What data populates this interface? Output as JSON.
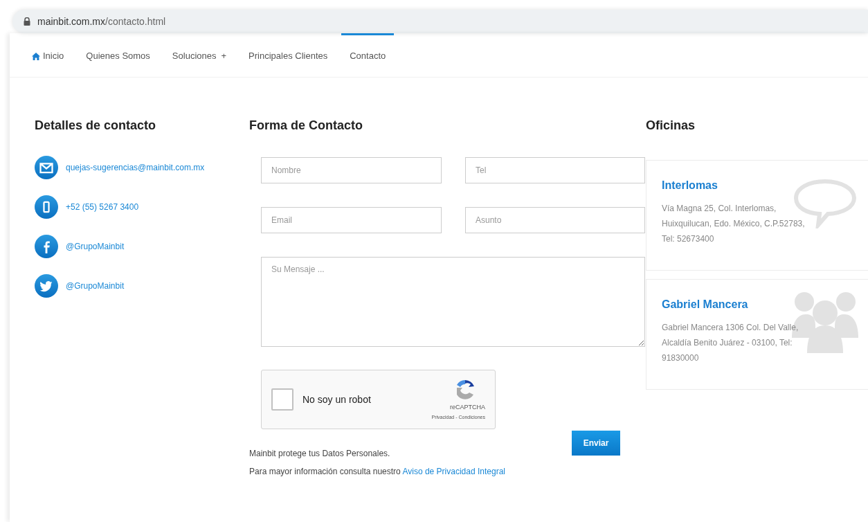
{
  "address_bar": {
    "domain": "mainbit.com.mx",
    "path": "/contacto.html"
  },
  "nav": [
    {
      "label": "Inicio",
      "kind": "home",
      "selected": false
    },
    {
      "label": "Quienes Somos",
      "selected": false
    },
    {
      "label": "Soluciones",
      "suffix": "+",
      "selected": false
    },
    {
      "label": "Principales Clientes",
      "selected": false
    },
    {
      "label": "Contacto",
      "selected": true
    }
  ],
  "contact_details": {
    "title": "Detalles de contacto",
    "items": [
      {
        "kind": "email",
        "text": "quejas-sugerencias@mainbit.com.mx"
      },
      {
        "kind": "phone",
        "text": "+52 (55) 5267 3400"
      },
      {
        "kind": "facebook",
        "text": "@GrupoMainbit"
      },
      {
        "kind": "twitter",
        "text": "@GrupoMainbit"
      }
    ]
  },
  "form": {
    "title": "Forma de Contacto",
    "fields": [
      {
        "placeholder": "Nombre"
      },
      {
        "placeholder": "Tel"
      },
      {
        "placeholder": "Email"
      },
      {
        "placeholder": "Asunto"
      }
    ],
    "message": {
      "placeholder": "Su Mensaje ..."
    },
    "captcha": {
      "label": "No soy un robot",
      "checked": false,
      "brand": "reCAPTCHA",
      "links": "Privacidad - Condiciones"
    },
    "submit": "Enviar",
    "privacy_line_1": "Mainbit protege tus Datos Personales.",
    "privacy_line_2": "Para mayor información consulta nuestro ",
    "privacy_link": "Aviso de Privacidad Integral"
  },
  "offices": {
    "title": "Oficinas",
    "items": [
      {
        "name": "Interlomas",
        "kind": "bubble",
        "address": "Vía Magna 25, Col. Interlomas, Huixquilucan, Edo. México, C.P.52783, Tel: 52673400"
      },
      {
        "name": "Gabriel Mancera",
        "kind": "people",
        "address": "Gabriel Mancera 1306 Col. Del Valle, Alcaldía Benito Juárez - 03100, Tel: 91830000"
      }
    ]
  }
}
